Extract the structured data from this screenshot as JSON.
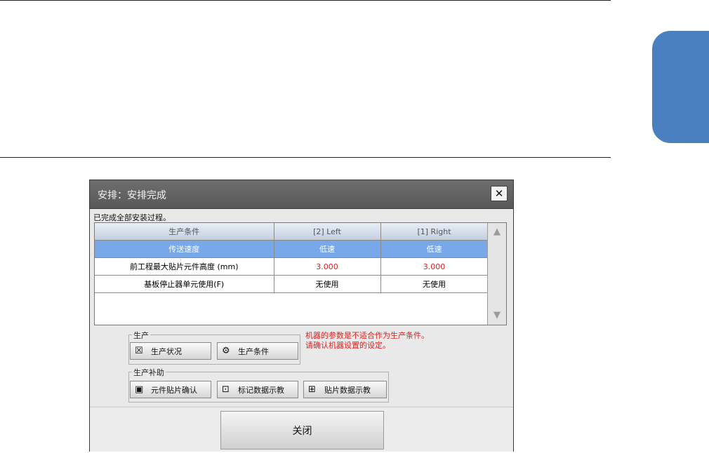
{
  "dialog": {
    "title": "安排：安排完成",
    "close_glyph": "✕",
    "message": "已完成全部安装过程。"
  },
  "table": {
    "headers": [
      "生产条件",
      "[2] Left",
      "[1] Right"
    ],
    "rows": [
      {
        "name": "传送速度",
        "left": "低速",
        "right": "低速",
        "selected": true
      },
      {
        "name": "前工程最大贴片元件高度 (mm)",
        "left": "3.000",
        "right": "3.000",
        "warning": true
      },
      {
        "name": "基板停止器单元使用(F)",
        "left": "无使用",
        "right": "无使用"
      }
    ],
    "scroll_up_icon": "▲",
    "scroll_down_icon": "▼"
  },
  "production_group": {
    "label": "生产",
    "buttons": [
      {
        "label": "生产状况",
        "icon": "status-icon"
      },
      {
        "label": "生产条件",
        "icon": "gear-icon"
      }
    ]
  },
  "warning": {
    "line1": "机器的参数是不适合作为生产条件。",
    "line2": "请确认机器设置的设定。"
  },
  "assist_group": {
    "label": "生产补助",
    "buttons": [
      {
        "label": "元件贴片确认",
        "icon": "component-check-icon"
      },
      {
        "label": "标记数据示教",
        "icon": "mark-teach-icon"
      },
      {
        "label": "贴片数据示教",
        "icon": "placement-teach-icon"
      }
    ]
  },
  "footer": {
    "close_label": "关闭"
  },
  "colors": {
    "accent_tab": "#4a80bf",
    "selected_row": "#78a8e8",
    "warning_text": "#e02020"
  }
}
